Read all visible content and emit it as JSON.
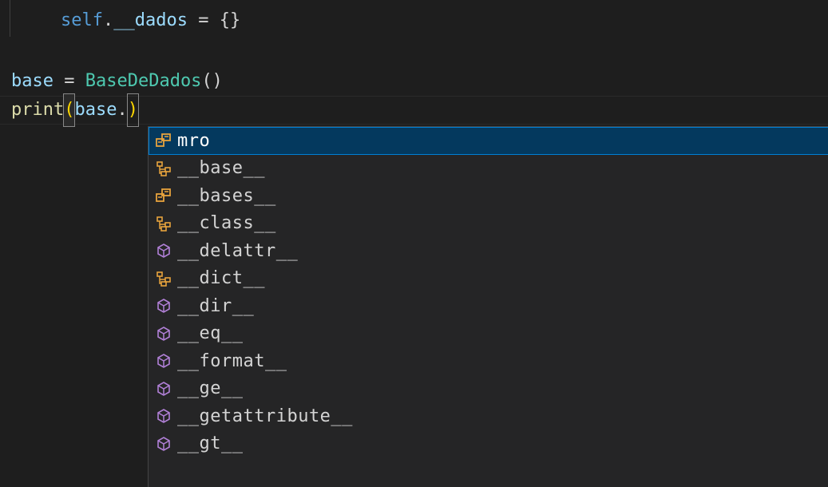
{
  "editor": {
    "lines": {
      "l1": {
        "self": "self",
        "dot": ".",
        "attr": "__dados",
        "eq": " = ",
        "value": "{}"
      },
      "l3": {
        "var": "base",
        "eq": " = ",
        "cls": "BaseDeDados",
        "call": "()"
      },
      "l4": {
        "fn": "print",
        "paren_open": "(",
        "var": "base",
        "dot": ".",
        "paren_close": ")"
      }
    }
  },
  "suggestions": {
    "items": [
      {
        "label": "mro",
        "icon": "method-icon",
        "selected": true
      },
      {
        "label": "__base__",
        "icon": "class-icon"
      },
      {
        "label": "__bases__",
        "icon": "method-icon"
      },
      {
        "label": "__class__",
        "icon": "class-icon"
      },
      {
        "label": "__delattr__",
        "icon": "cube-icon"
      },
      {
        "label": "__dict__",
        "icon": "class-icon"
      },
      {
        "label": "__dir__",
        "icon": "cube-icon"
      },
      {
        "label": "__eq__",
        "icon": "cube-icon"
      },
      {
        "label": "__format__",
        "icon": "cube-icon"
      },
      {
        "label": "__ge__",
        "icon": "cube-icon"
      },
      {
        "label": "__getattribute__",
        "icon": "cube-icon"
      },
      {
        "label": "__gt__",
        "icon": "cube-icon"
      }
    ],
    "info_icon": "info-icon"
  },
  "colors": {
    "method": "#e8a33d",
    "class": "#e8a33d",
    "cube": "#b180d7",
    "selected_bg": "#04395e"
  }
}
